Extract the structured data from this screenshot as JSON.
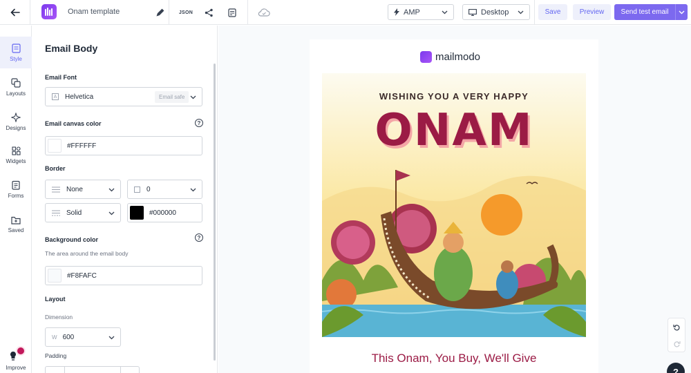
{
  "header": {
    "template_name": "Onam template",
    "json_label": "JSON",
    "format_select": "AMP",
    "device_select": "Desktop",
    "save_label": "Save",
    "preview_label": "Preview",
    "send_test_label": "Send test email"
  },
  "rail": {
    "items": [
      {
        "label": "Style",
        "icon": "style-icon"
      },
      {
        "label": "Layouts",
        "icon": "layouts-icon"
      },
      {
        "label": "Designs",
        "icon": "designs-icon"
      },
      {
        "label": "Widgets",
        "icon": "widgets-icon"
      },
      {
        "label": "Forms",
        "icon": "forms-icon"
      },
      {
        "label": "Saved",
        "icon": "saved-icon"
      }
    ],
    "improve_label": "Improve"
  },
  "panel": {
    "title": "Email Body",
    "email_font": {
      "label": "Email Font",
      "value": "Helvetica",
      "badge": "Email safe"
    },
    "canvas_color": {
      "label": "Email canvas color",
      "value": "#FFFFFF"
    },
    "border": {
      "label": "Border",
      "style_value": "None",
      "width_value": "0",
      "line_value": "Solid",
      "color_value": "#000000"
    },
    "background_color": {
      "label": "Background color",
      "hint": "The area around the email body",
      "value": "#F8FAFC"
    },
    "layout": {
      "label": "Layout",
      "dimension_label": "Dimension",
      "dimension_prefix": "W",
      "dimension_value": "600",
      "padding_label": "Padding"
    }
  },
  "email": {
    "brand": "mailmodo",
    "hero_line1": "WISHING YOU A VERY HAPPY",
    "hero_line2": "ONAM",
    "headline": "This Onam, You Buy, We'll Give"
  },
  "colors": {
    "accent": "#7c69ef",
    "brand_red": "#9b1b45",
    "canvas_bg": "#f8fafc"
  }
}
